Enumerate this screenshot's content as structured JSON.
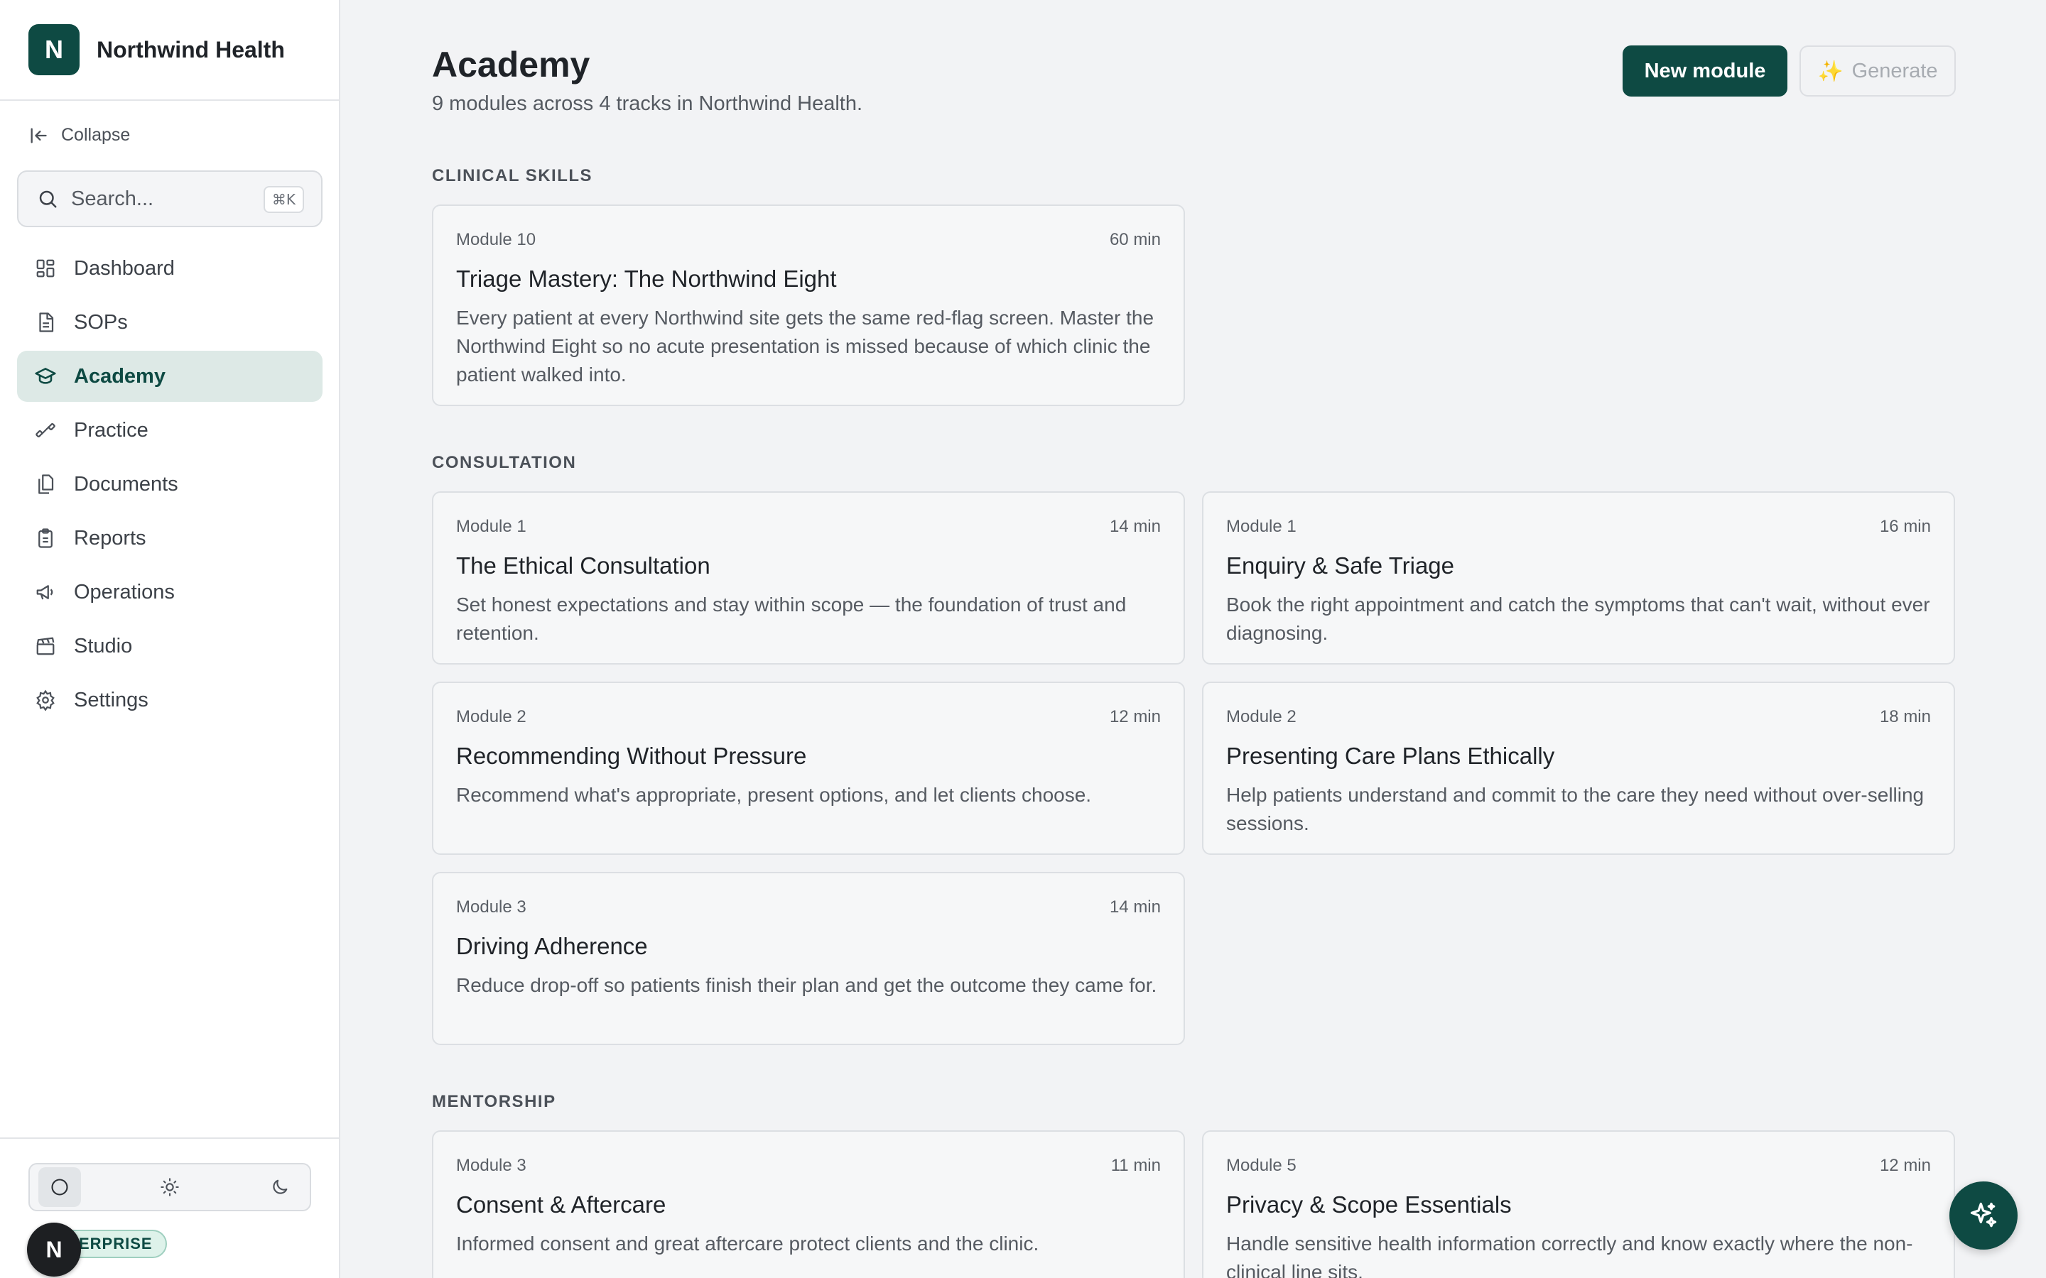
{
  "brand": {
    "logo_letter": "N",
    "name": "Northwind Health"
  },
  "sidebar": {
    "collapse_label": "Collapse",
    "search": {
      "placeholder": "Search...",
      "shortcut": "⌘K"
    },
    "items": [
      {
        "label": "Dashboard",
        "icon": "dashboard-icon"
      },
      {
        "label": "SOPs",
        "icon": "document-icon"
      },
      {
        "label": "Academy",
        "icon": "graduation-cap-icon",
        "active": true
      },
      {
        "label": "Practice",
        "icon": "dumbbell-icon"
      },
      {
        "label": "Documents",
        "icon": "files-icon"
      },
      {
        "label": "Reports",
        "icon": "clipboard-icon"
      },
      {
        "label": "Operations",
        "icon": "megaphone-icon"
      },
      {
        "label": "Studio",
        "icon": "clapperboard-icon"
      },
      {
        "label": "Settings",
        "icon": "gear-icon"
      }
    ],
    "footer": {
      "theme_options": [
        "system",
        "light",
        "dark"
      ],
      "selected_theme": "system",
      "badge": "ENTERPRISE",
      "avatar_letter": "N"
    }
  },
  "header": {
    "title": "Academy",
    "subtitle": "9 modules across 4 tracks in Northwind Health.",
    "new_button": "New module",
    "generate_button": "Generate"
  },
  "sections": [
    {
      "title": "CLINICAL SKILLS",
      "modules": [
        {
          "module": "Module 10",
          "duration": "60 min",
          "title": "Triage Mastery: The Northwind Eight",
          "description": "Every patient at every Northwind site gets the same red-flag screen. Master the Northwind Eight so no acute presentation is missed because of which clinic the patient walked into."
        }
      ]
    },
    {
      "title": "CONSULTATION",
      "modules": [
        {
          "module": "Module 1",
          "duration": "14 min",
          "title": "The Ethical Consultation",
          "description": "Set honest expectations and stay within scope — the foundation of trust and retention."
        },
        {
          "module": "Module 1",
          "duration": "16 min",
          "title": "Enquiry & Safe Triage",
          "description": "Book the right appointment and catch the symptoms that can't wait, without ever diagnosing."
        },
        {
          "module": "Module 2",
          "duration": "12 min",
          "title": "Recommending Without Pressure",
          "description": "Recommend what's appropriate, present options, and let clients choose."
        },
        {
          "module": "Module 2",
          "duration": "18 min",
          "title": "Presenting Care Plans Ethically",
          "description": "Help patients understand and commit to the care they need without over-selling sessions."
        },
        {
          "module": "Module 3",
          "duration": "14 min",
          "title": "Driving Adherence",
          "description": "Reduce drop-off so patients finish their plan and get the outcome they came for."
        }
      ]
    },
    {
      "title": "MENTORSHIP",
      "modules": [
        {
          "module": "Module 3",
          "duration": "11 min",
          "title": "Consent & Aftercare",
          "description": "Informed consent and great aftercare protect clients and the clinic."
        },
        {
          "module": "Module 5",
          "duration": "12 min",
          "title": "Privacy & Scope Essentials",
          "description": "Handle sensitive health information correctly and know exactly where the non-clinical line sits."
        }
      ]
    }
  ],
  "colors": {
    "accent": "#0e4a43",
    "active_nav_bg": "#dde9e6",
    "page_bg": "#f2f3f5"
  },
  "fab": {
    "icon": "sparkles-icon"
  }
}
